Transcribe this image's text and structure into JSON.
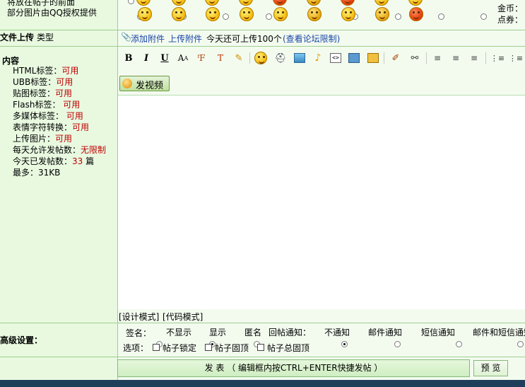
{
  "top": {
    "notice_line1": "将放在帖子的前面",
    "notice_line2": "部分图片由QQ授权提供",
    "gold_label": "金币：",
    "coupon_label": "点券："
  },
  "upload": {
    "label": "文件上传",
    "type_label": "类型",
    "add_attachment": "添加附件",
    "upload_attachment": "上传附件",
    "today_limit": "今天还可上传100个",
    "view_limit": "(查看论坛限制)"
  },
  "content": {
    "label": "内容",
    "rules": [
      {
        "name": "HTML标签：",
        "value": "可用"
      },
      {
        "name": "UBB标签：",
        "value": "可用"
      },
      {
        "name": "贴图标签：",
        "value": "可用"
      },
      {
        "name": "Flash标签：",
        "value": " 可用"
      },
      {
        "name": "多媒体标签：",
        "value": " 可用"
      },
      {
        "name": "表情字符转换：",
        "value": "可用"
      },
      {
        "name": "上传图片：",
        "value": "可用"
      },
      {
        "name": "每天允许发帖数：",
        "value": "无限制"
      }
    ],
    "posted_today_label": "今天已发帖数：",
    "posted_today_value": "33",
    "posted_today_unit": " 篇",
    "max_label": "最多：31KB"
  },
  "toolbar": {
    "bold": "B",
    "italic": "I",
    "underline": "U",
    "video_button": "发视频"
  },
  "editor": {
    "mode_design": "[设计模式]",
    "mode_code": "[代码模式]"
  },
  "advanced": {
    "label": "高级设置：",
    "signature_label": "签名：",
    "sig_hide": "不显示",
    "sig_show": "显示",
    "sig_anon": "匿名",
    "reply_notify_label": "回帖通知：",
    "notify_none": "不通知",
    "notify_mail": "邮件通知",
    "notify_sms": "短信通知",
    "notify_both": "邮件和短信通知",
    "options_label": "选项：",
    "opt_lock": "帖子锁定",
    "opt_top": "帖子固顶",
    "opt_total_top": "帖子总固顶"
  },
  "actions": {
    "submit": "发 表 （ 编辑框内按CTRL+ENTER快捷发帖 ）",
    "preview": "预 览"
  },
  "colors": {
    "panel_bg": "#e8f9e0",
    "border": "#9dcf8c",
    "accent_red": "#c00000",
    "link_blue": "#1a46a8"
  }
}
